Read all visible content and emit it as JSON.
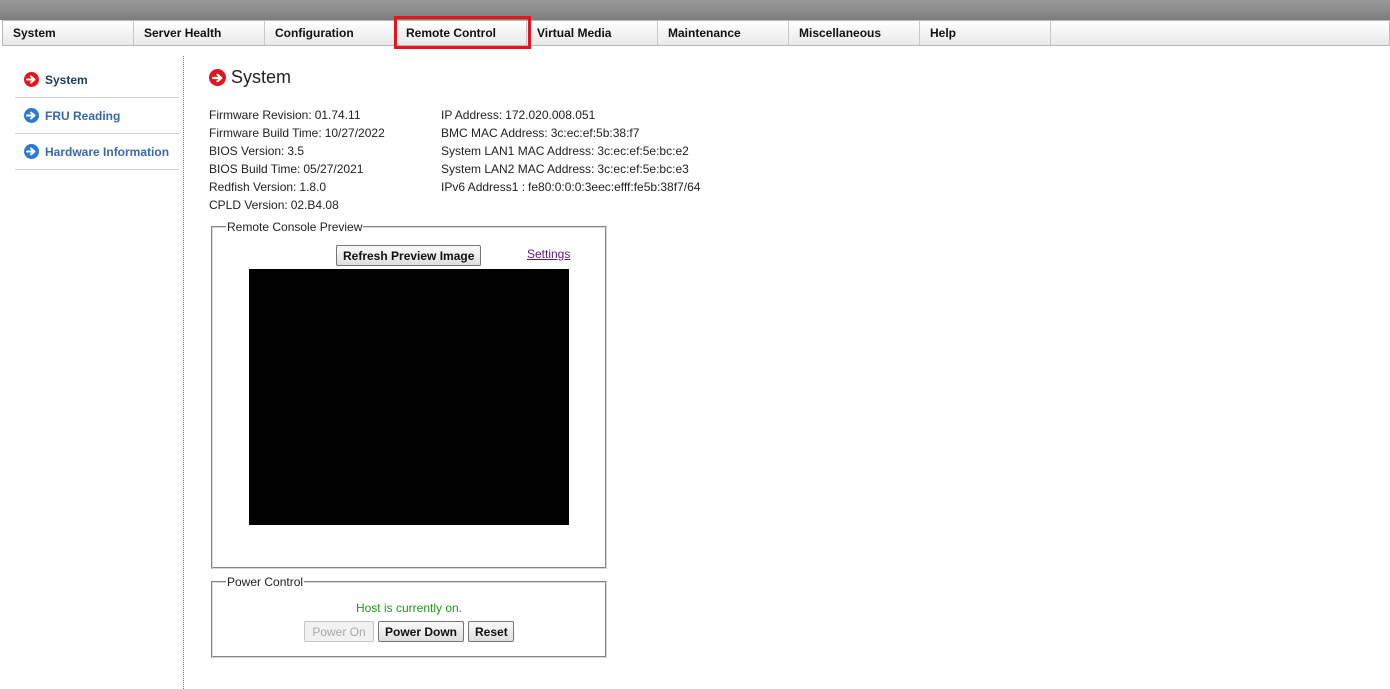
{
  "menu": {
    "items": [
      {
        "label": "System"
      },
      {
        "label": "Server Health"
      },
      {
        "label": "Configuration"
      },
      {
        "label": "Remote Control"
      },
      {
        "label": "Virtual Media"
      },
      {
        "label": "Maintenance"
      },
      {
        "label": "Miscellaneous"
      },
      {
        "label": "Help"
      }
    ],
    "highlighted": "Remote Control",
    "highlight_color": "#e8141b"
  },
  "sidebar": {
    "items": [
      {
        "label": "System",
        "icon": "arrow-right-circle-icon",
        "icon_color": "#e2161c",
        "active": true
      },
      {
        "label": "FRU Reading",
        "icon": "arrow-right-circle-icon",
        "icon_color": "#2b7ad6",
        "active": false
      },
      {
        "label": "Hardware Information",
        "icon": "arrow-right-circle-icon",
        "icon_color": "#2b7ad6",
        "active": false
      }
    ]
  },
  "page": {
    "title": "System",
    "title_icon": "arrow-right-circle-icon"
  },
  "info_left": [
    {
      "label": "Firmware Revision:",
      "value": "01.74.11"
    },
    {
      "label": "Firmware Build Time:",
      "value": "10/27/2022"
    },
    {
      "label": "BIOS Version:",
      "value": "3.5"
    },
    {
      "label": "BIOS Build Time:",
      "value": "05/27/2021"
    },
    {
      "label": "Redfish Version:",
      "value": "1.8.0"
    },
    {
      "label": "CPLD Version:",
      "value": "02.B4.08"
    }
  ],
  "info_right": [
    {
      "label": "IP Address:",
      "value": "172.020.008.051"
    },
    {
      "label": "BMC MAC Address:",
      "value": "3c:ec:ef:5b:38:f7"
    },
    {
      "label": "System LAN1 MAC Address:",
      "value": "3c:ec:ef:5e:bc:e2"
    },
    {
      "label": "System LAN2 MAC Address:",
      "value": "3c:ec:ef:5e:bc:e3"
    },
    {
      "label": "IPv6 Address1 :",
      "value": "fe80:0:0:0:3eec:efff:fe5b:38f7/64"
    }
  ],
  "console_preview": {
    "legend": "Remote Console Preview",
    "refresh_label": "Refresh Preview Image",
    "settings_label": "Settings"
  },
  "power_control": {
    "legend": "Power Control",
    "status": "Host is currently on.",
    "status_color": "#1a9a1a",
    "power_on_label": "Power On",
    "power_on_enabled": false,
    "power_down_label": "Power Down",
    "reset_label": "Reset"
  }
}
